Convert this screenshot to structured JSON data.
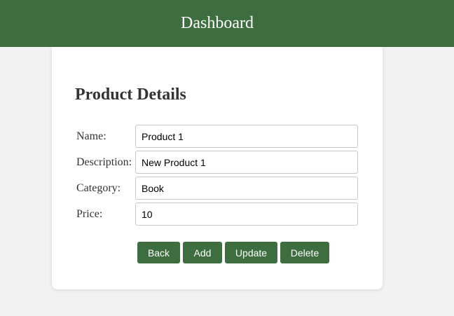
{
  "header": {
    "title": "Dashboard"
  },
  "card": {
    "title": "Product Details",
    "fields": [
      {
        "label": "Name:",
        "value": "Product 1"
      },
      {
        "label": "Description:",
        "value": "New Product 1"
      },
      {
        "label": "Category:",
        "value": "Book"
      },
      {
        "label": "Price:",
        "value": "10"
      }
    ],
    "buttons": {
      "back": "Back",
      "add": "Add",
      "update": "Update",
      "delete": "Delete"
    }
  },
  "colors": {
    "header_bg": "#3e6e40",
    "button_bg": "#3e6e40",
    "page_bg": "#f2f2f2",
    "card_bg": "#ffffff"
  }
}
